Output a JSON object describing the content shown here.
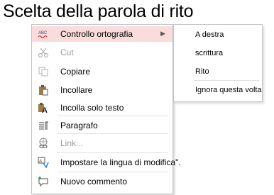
{
  "title": "Scelta della parola di rito",
  "menu": {
    "items": [
      {
        "label": "Controllo ortografia",
        "icon": "spell-check-icon",
        "highlighted": true,
        "submenu": true
      },
      {
        "label": "Cut",
        "icon": "scissors-icon",
        "disabled": true
      },
      {
        "label": "Copiare",
        "icon": "copy-icon"
      },
      {
        "label": "Incollare",
        "icon": "paste-icon"
      },
      {
        "label": "Incolla solo testo",
        "icon": "paste-text-only-icon"
      },
      {
        "label": "Paragrafo",
        "icon": "paragraph-icon"
      },
      {
        "label": "Link...",
        "icon": "link-icon",
        "disabled": true
      },
      {
        "label": "Impostare la lingua di modifica\".",
        "icon": "language-icon"
      },
      {
        "label": "Nuovo commento",
        "icon": "new-comment-icon"
      }
    ],
    "highlight_color": "#fadcdc"
  },
  "submenu": {
    "items": [
      {
        "label": "A destra"
      },
      {
        "label": "scrittura"
      },
      {
        "label": "Rito"
      },
      {
        "label": "Ignora questa volta"
      }
    ]
  }
}
